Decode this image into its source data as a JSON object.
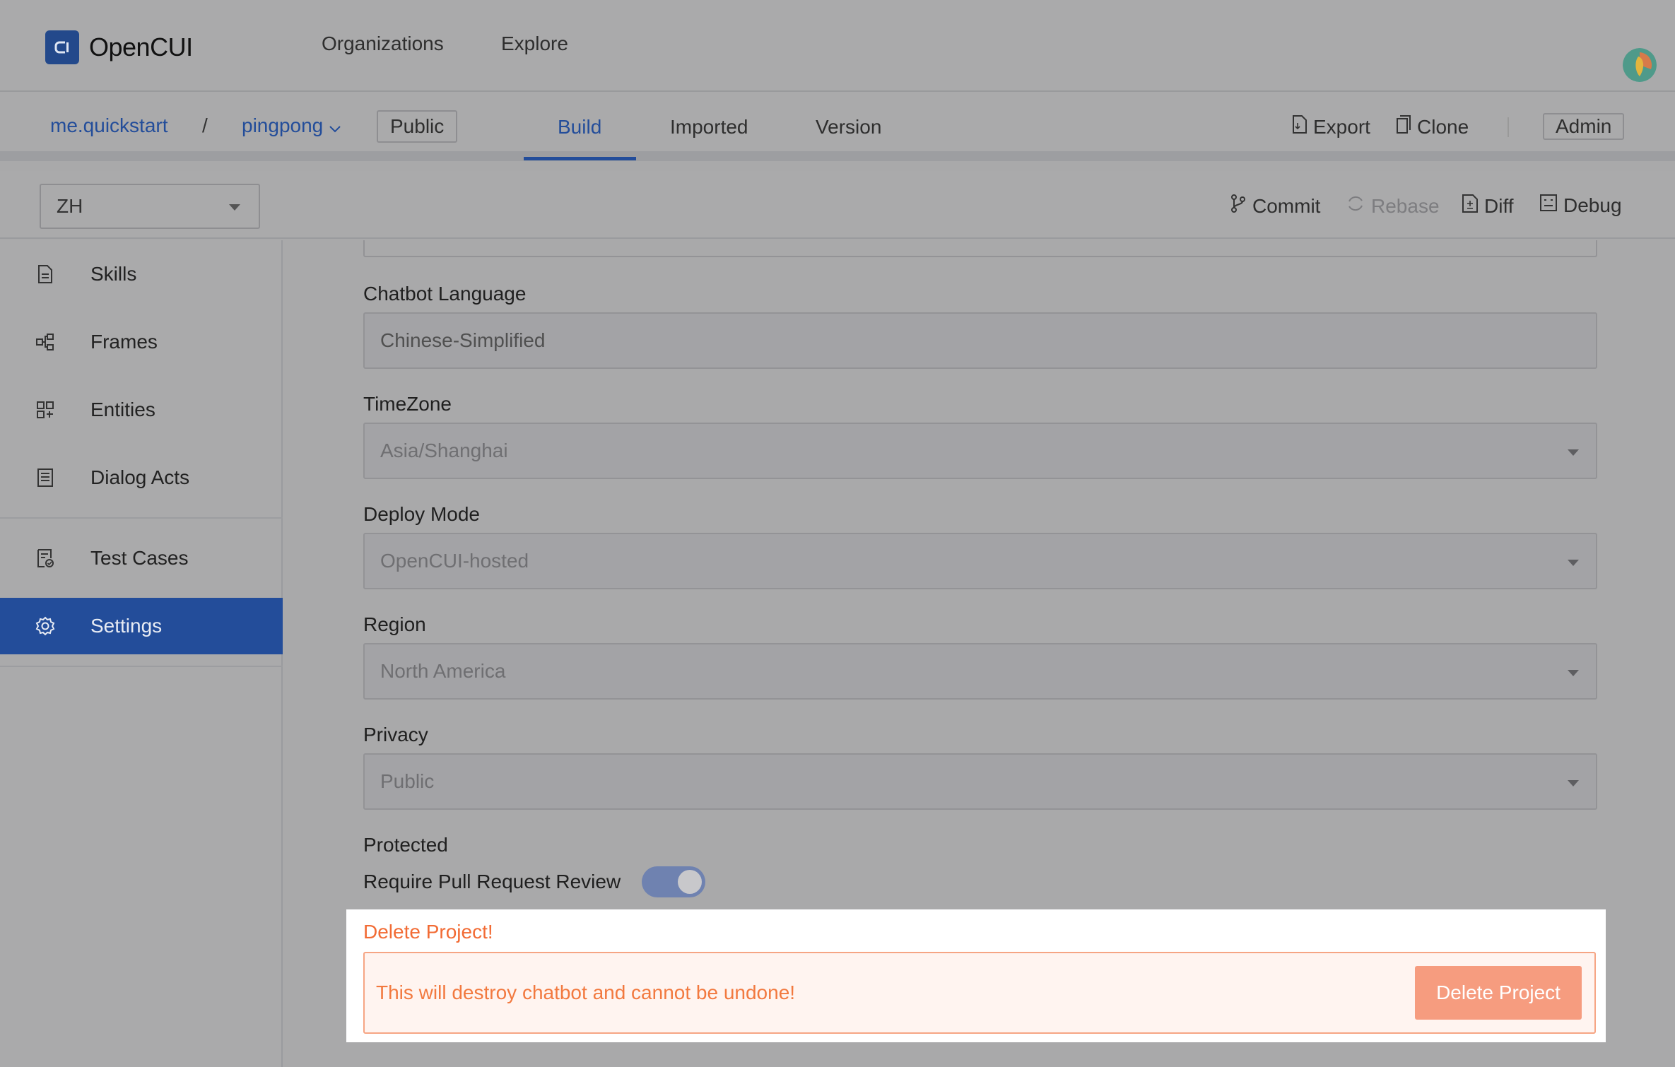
{
  "app": {
    "name": "OpenCUI",
    "nav": [
      "Organizations",
      "Explore"
    ]
  },
  "project": {
    "org": "me.quickstart",
    "separator": "/",
    "name": "pingpong",
    "visibility": "Public",
    "tabs": [
      "Build",
      "Imported",
      "Version"
    ],
    "active_tab": "Build",
    "actions": {
      "export": "Export",
      "clone": "Clone",
      "role": "Admin"
    }
  },
  "toolbar": {
    "language": "ZH",
    "commit": "Commit",
    "rebase": "Rebase",
    "diff": "Diff",
    "debug": "Debug"
  },
  "sidebar": {
    "items": [
      {
        "label": "Skills",
        "icon": "document-icon"
      },
      {
        "label": "Frames",
        "icon": "frames-icon"
      },
      {
        "label": "Entities",
        "icon": "grid-icon"
      },
      {
        "label": "Dialog Acts",
        "icon": "list-doc-icon"
      },
      {
        "label": "Test Cases",
        "icon": "test-doc-icon"
      },
      {
        "label": "Settings",
        "icon": "gear-icon"
      }
    ],
    "active": "Settings"
  },
  "settings": {
    "chatbot_language": {
      "label": "Chatbot Language",
      "value": "Chinese-Simplified"
    },
    "timezone": {
      "label": "TimeZone",
      "value": "Asia/Shanghai"
    },
    "deploy_mode": {
      "label": "Deploy Mode",
      "value": "OpenCUI-hosted"
    },
    "region": {
      "label": "Region",
      "value": "North America"
    },
    "privacy": {
      "label": "Privacy",
      "value": "Public"
    },
    "protected": {
      "label": "Protected",
      "require_pr_label": "Require Pull Request Review",
      "require_pr_enabled": true
    }
  },
  "danger": {
    "title": "Delete Project!",
    "message": "This will destroy chatbot and cannot be undone!",
    "button": "Delete Project"
  },
  "colors": {
    "brand": "#234d9a",
    "danger_text": "#f26b34",
    "danger_button": "#f69c7f"
  }
}
